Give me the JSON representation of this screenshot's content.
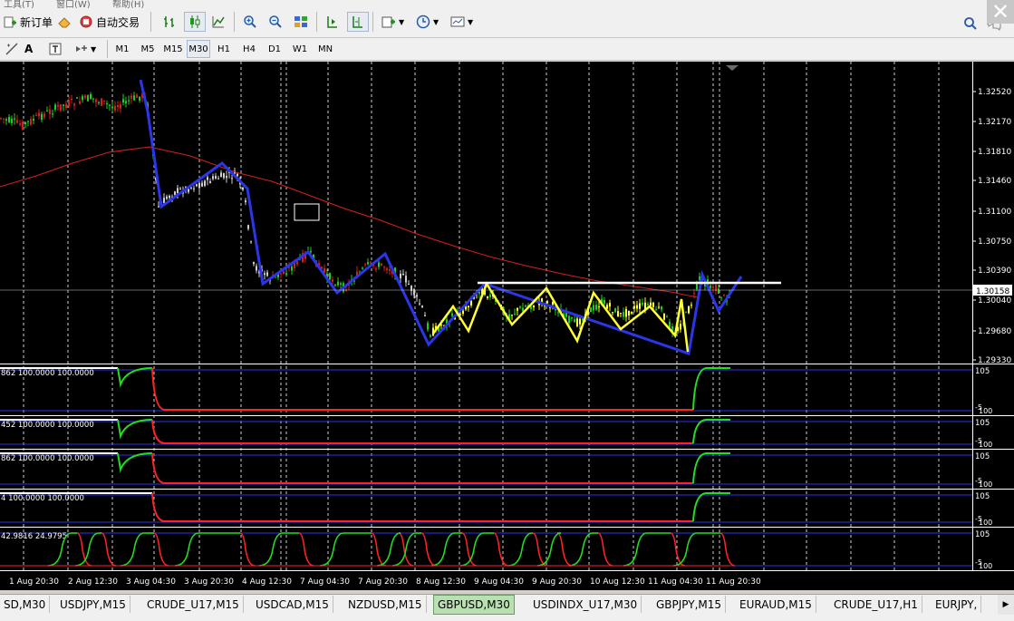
{
  "menu": {
    "tools": "工具(T)",
    "window": "窗口(W)",
    "help": "帮助(H)"
  },
  "toolbar": {
    "new_order": "新订单",
    "auto_trade": "自动交易"
  },
  "timeframes": [
    "M1",
    "M5",
    "M15",
    "M30",
    "H1",
    "H4",
    "D1",
    "W1",
    "MN"
  ],
  "active_timeframe": "M30",
  "chart": {
    "symbol": "GBPUSD,M30",
    "current_price": "1.30158",
    "price_ticks": [
      "1.32520",
      "1.32170",
      "1.31810",
      "1.31460",
      "1.31100",
      "1.30750",
      "1.30390",
      "1.30040",
      "1.29680",
      "1.29330"
    ],
    "time_ticks": [
      "1 Aug 20:30",
      "2 Aug 12:30",
      "3 Aug 04:30",
      "3 Aug 20:30",
      "4 Aug 12:30",
      "7 Aug 04:30",
      "7 Aug 20:30",
      "8 Aug 12:30",
      "9 Aug 04:30",
      "9 Aug 20:30",
      "10 Aug 12:30",
      "11 Aug 04:30",
      "11 Aug 20:30"
    ],
    "indicators": [
      {
        "label": "862 100.0000 100.0000",
        "top": "105",
        "bottom": "-5",
        "bottom2": "100"
      },
      {
        "label": "452 100.0000 100.0000",
        "top": "105",
        "bottom": "-5",
        "bottom2": "100"
      },
      {
        "label": "862 100.0000 100.0000",
        "top": "105",
        "bottom": "-5",
        "bottom2": "100"
      },
      {
        "label": "4 100.0000 100.0000",
        "top": "105",
        "bottom": "-5",
        "bottom2": "100"
      },
      {
        "label": "42.9816 24.9795",
        "top": "105",
        "bottom": "-5",
        "bottom2": "100"
      }
    ],
    "colors": {
      "bg": "#000000",
      "grid": "#ffffff",
      "ma": "#d42020",
      "zigzag_blue": "#2a36e8",
      "zigzag_yellow": "#ffff33",
      "level": "#ffffff",
      "osc_up": "#22dd22",
      "osc_down": "#ff2222",
      "level_line": "#2a36e8"
    }
  },
  "symbol_tabs": [
    "SD,M30",
    "USDJPY,M15",
    "CRUDE_U17,M15",
    "USDCAD,M15",
    "NZDUSD,M15",
    "GBPUSD,M30",
    "USDINDX_U17,M30",
    "GBPJPY,M15",
    "EURAUD,M15",
    "CRUDE_U17,H1",
    "EURJPY,"
  ],
  "active_tab": "GBPUSD,M30"
}
